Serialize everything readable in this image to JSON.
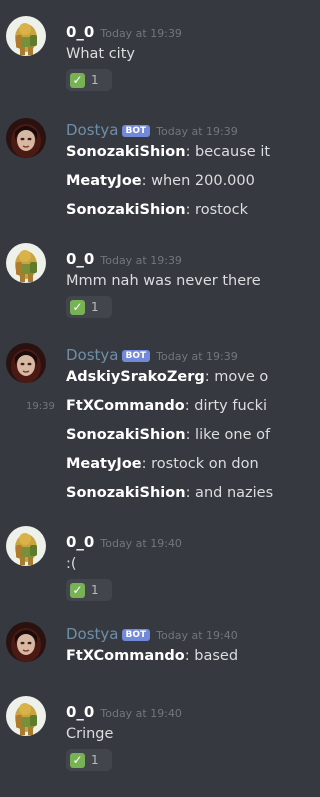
{
  "messages": [
    {
      "author": "0_0",
      "time": "Today at 19:39",
      "text": "What city",
      "reaction_count": "1"
    },
    {
      "author": "Dostya",
      "badge": "BOT",
      "time": "Today at 19:39",
      "lines": [
        {
          "user": "SonozakiShion",
          "text": ": because it"
        },
        {
          "user": "MeatyJoe",
          "text": ": when 200.000"
        },
        {
          "user": "SonozakiShion",
          "text": ": rostock"
        }
      ]
    },
    {
      "author": "0_0",
      "time": "Today at 19:39",
      "text": "Mmm nah was never there",
      "reaction_count": "1"
    },
    {
      "author": "Dostya",
      "badge": "BOT",
      "time": "Today at 19:39",
      "side_time": "19:39",
      "lines": [
        {
          "user": "AdskiySrakoZerg",
          "text": ": move o"
        },
        {
          "user": "FtXCommando",
          "text": ": dirty fucki"
        },
        {
          "user": "SonozakiShion",
          "text": ": like one of"
        },
        {
          "user": "MeatyJoe",
          "text": ": rostock on don"
        },
        {
          "user": "SonozakiShion",
          "text": ": and nazies"
        }
      ]
    },
    {
      "author": "0_0",
      "time": "Today at 19:40",
      "text": ":(",
      "reaction_count": "1"
    },
    {
      "author": "Dostya",
      "badge": "BOT",
      "time": "Today at 19:40",
      "lines": [
        {
          "user": "FtXCommando",
          "text": ": based"
        }
      ]
    },
    {
      "author": "0_0",
      "time": "Today at 19:40",
      "text": "Cringe",
      "reaction_count": "1"
    }
  ],
  "colors": {
    "background": "#36393f",
    "bot_name": "#6f8fa8",
    "bot_badge": "#7289da",
    "reaction_check": "#77b255"
  }
}
